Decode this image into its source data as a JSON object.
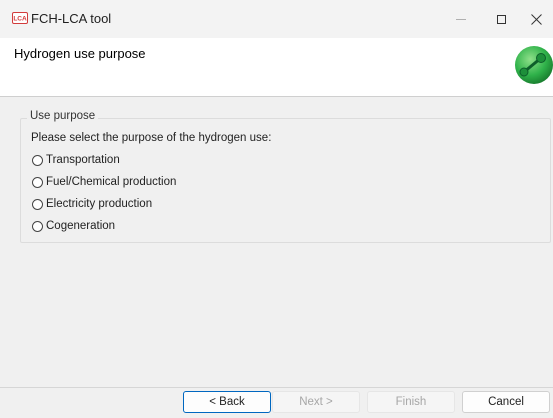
{
  "window": {
    "title": "FCH-LCA tool",
    "app_icon_text": "LCA",
    "controls": {
      "minimize_glyph": "—",
      "maximize_glyph": "☐",
      "close_glyph": "✕"
    }
  },
  "header": {
    "title": "Hydrogen use purpose",
    "logo_icon": "hydrogen-molecule-logo"
  },
  "group": {
    "legend": "Use purpose",
    "prompt": "Please select the purpose of the hydrogen use:",
    "options": [
      {
        "label": "Transportation",
        "selected": false
      },
      {
        "label": "Fuel/Chemical production",
        "selected": false
      },
      {
        "label": "Electricity production",
        "selected": false
      },
      {
        "label": "Cogeneration",
        "selected": false
      }
    ]
  },
  "footer": {
    "back_label": "< Back",
    "next_label": "Next >",
    "finish_label": "Finish",
    "cancel_label": "Cancel"
  },
  "colors": {
    "accent": "#0067c0",
    "logo_green": "#2fb24a",
    "panel_bg": "#f0f0f0"
  }
}
